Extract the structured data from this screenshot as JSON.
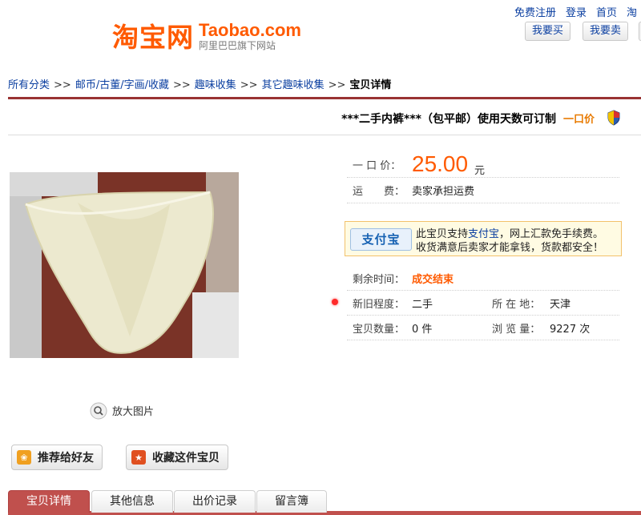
{
  "header": {
    "logo_cn": "淘宝网",
    "logo_en": "Taobao.com",
    "logo_sub": "阿里巴巴旗下网站",
    "links": [
      "免费注册",
      "登录",
      "首页",
      "淘"
    ],
    "buy_button": "我要买",
    "sell_button": "我要卖"
  },
  "breadcrumb": {
    "items": [
      "所有分类",
      "邮币/古董/字画/收藏",
      "趣味收集",
      "其它趣味收集"
    ],
    "separator": ">>",
    "current": "宝贝详情"
  },
  "item": {
    "title": "***二手内裤***（包平邮）使用天数可订制",
    "sale_type": "一口价"
  },
  "info": {
    "price_label": "一 口 价：",
    "price": "25.00",
    "price_unit": "元",
    "shipping_label": "运　　费：",
    "shipping_value": "卖家承担运费",
    "alipay_logo": "支付宝",
    "alipay_line1_pre": "此宝贝支持",
    "alipay_line1_link": "支付宝",
    "alipay_line1_post": "，网上汇款免手续费。",
    "alipay_line2": "收货满意后卖家才能拿钱，货款都安全！",
    "remaining_label": "剩余时间：",
    "remaining_value": "成交结束",
    "condition_label": "新旧程度：",
    "condition_value": "二手",
    "location_label": "所 在 地：",
    "location_value": "天津",
    "quantity_label": "宝贝数量：",
    "quantity_value": "0 件",
    "views_label": "浏 览 量：",
    "views_value": "9227 次"
  },
  "photo": {
    "zoom_label": "放大图片"
  },
  "actions": {
    "recommend": "推荐给好友",
    "favorite": "收藏这件宝贝"
  },
  "tabs": [
    "宝贝详情",
    "其他信息",
    "出价记录",
    "留言簿"
  ],
  "colors": {
    "brand_orange": "#ff5a00",
    "link_blue": "#0a3ea0",
    "tab_red": "#c0504d"
  }
}
